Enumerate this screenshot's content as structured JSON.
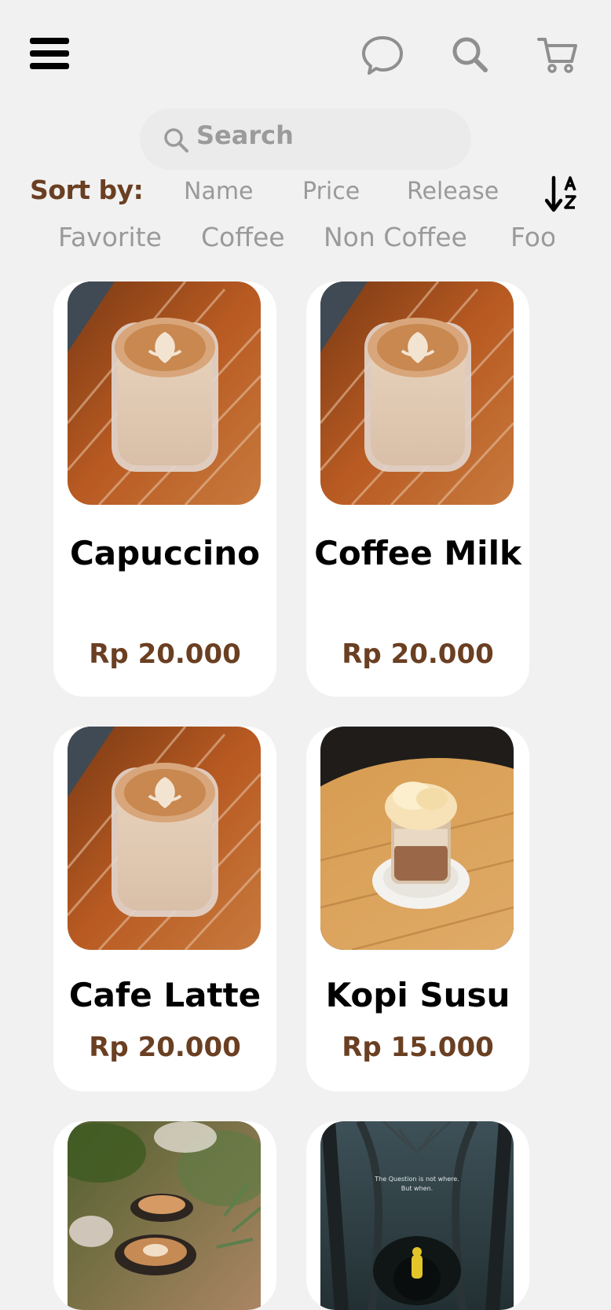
{
  "search": {
    "placeholder": "Search"
  },
  "sort": {
    "label": "Sort by:",
    "options": [
      "Name",
      "Price",
      "Release"
    ]
  },
  "filters": [
    "Favorite",
    "Coffee",
    "Non Coffee",
    "Food"
  ],
  "products": [
    {
      "name": "Capuccino",
      "price": "Rp 20.000"
    },
    {
      "name": "Coffee Milk",
      "price": "Rp 20.000"
    },
    {
      "name": "Cafe Latte",
      "price": "Rp 20.000"
    },
    {
      "name": "Kopi Susu",
      "price": "Rp 15.000"
    },
    {
      "name": "",
      "price": ""
    },
    {
      "name": "",
      "price": ""
    }
  ],
  "poster_text": {
    "line1": "The Question is not where.",
    "line2": "But when."
  },
  "icons": {
    "menu": "hamburger-menu-icon",
    "chat": "chat-bubble-icon",
    "search": "search-icon",
    "cart": "shopping-cart-icon",
    "sort": "sort-a-z-icon"
  },
  "colors": {
    "background": "#f1f1f1",
    "card": "#ffffff",
    "accent_brown": "#6a3f22",
    "muted_text": "#9a9a9a"
  }
}
